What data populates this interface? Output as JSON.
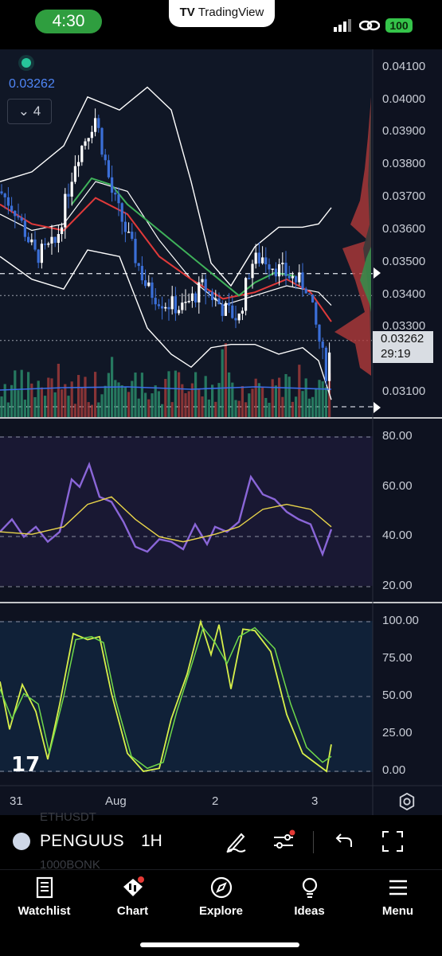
{
  "status_bar": {
    "time": "4:30",
    "app_name": "TradingView",
    "battery": "100"
  },
  "chart": {
    "last_value": "0.03262",
    "indicators_count": "4",
    "price_tag": {
      "price": "0.03262",
      "countdown": "29:19"
    },
    "price_axis": [
      "0.04100",
      "0.04000",
      "0.03900",
      "0.03800",
      "0.03700",
      "0.03600",
      "0.03500",
      "0.03400",
      "0.03300",
      "0.03100"
    ],
    "rsi_axis": [
      "80.00",
      "60.00",
      "40.00",
      "20.00"
    ],
    "stoch_axis": [
      "100.00",
      "75.00",
      "50.00",
      "25.00",
      "0.00"
    ],
    "time_axis": [
      "31",
      "Aug",
      "2",
      "3"
    ],
    "colors": {
      "background": "#0e1220",
      "bull": "#3b6fd8",
      "bear": "#ffffff",
      "rsi": "#8a66d8",
      "rsi_ma": "#e8d44a",
      "stoch_k": "#d8f04a",
      "stoch_d": "#6fd84a",
      "bands": "#ffffff",
      "ema_red": "#e03a3a",
      "ema_green": "#3fb25a"
    }
  },
  "symbol_bar": {
    "symbol": "PENGUUS",
    "interval": "1H",
    "ghost_symbol_top": "ETHUSDT",
    "ghost_symbol_bottom": "1000BONK"
  },
  "bottom_nav": {
    "items": [
      {
        "label": "Watchlist",
        "icon": "bookmark-icon"
      },
      {
        "label": "Chart",
        "icon": "chart-candle-icon"
      },
      {
        "label": "Explore",
        "icon": "compass-icon"
      },
      {
        "label": "Ideas",
        "icon": "bulb-icon"
      },
      {
        "label": "Menu",
        "icon": "hamburger-icon"
      }
    ]
  }
}
